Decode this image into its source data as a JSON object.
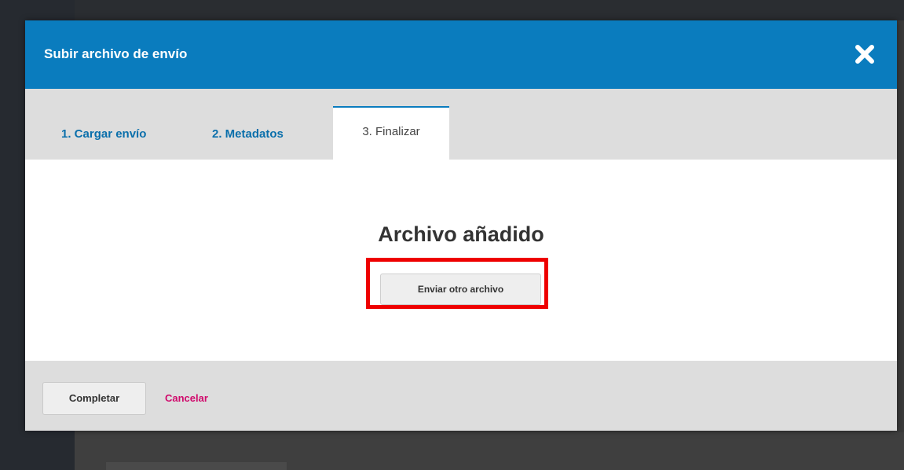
{
  "modal": {
    "title": "Subir archivo de envío",
    "close_icon": "close-icon",
    "accent_color": "#0a7cbe"
  },
  "tabs": [
    {
      "label": "1. Cargar envío",
      "active": false
    },
    {
      "label": "2. Metadatos",
      "active": false
    },
    {
      "label": "3. Finalizar",
      "active": true
    }
  ],
  "content": {
    "heading": "Archivo añadido",
    "another_file_button": "Enviar otro archivo",
    "highlight_color": "#ee0000"
  },
  "footer": {
    "complete_button": "Completar",
    "cancel_link": "Cancelar",
    "cancel_color": "#d00a6c"
  }
}
